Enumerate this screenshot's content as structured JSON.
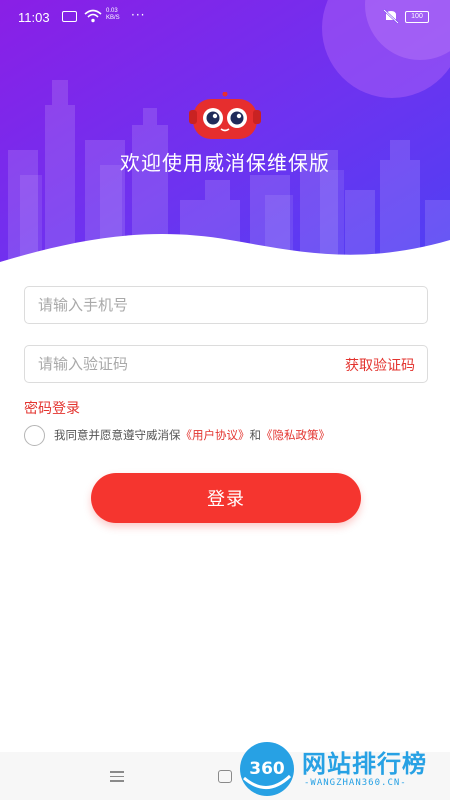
{
  "status_bar": {
    "time": "11:03",
    "net_speed_value": "0.03",
    "net_speed_unit": "KB/S",
    "more": "···",
    "battery": "100",
    "icons": [
      "notification-icon",
      "wifi-icon",
      "mute-icon",
      "battery-icon"
    ]
  },
  "header": {
    "welcome": "欢迎使用威消保维保版",
    "gradient_colors": [
      "#6a2df0",
      "#9a2be8",
      "#4b3bf2"
    ]
  },
  "form": {
    "phone_placeholder": "请输入手机号",
    "code_placeholder": "请输入验证码",
    "get_code_label": "获取验证码",
    "password_login_label": "密码登录",
    "agreement": {
      "prefix": "我同意并愿意遵守威消保",
      "user_agreement": "《用户协议》",
      "conjunction": "和",
      "privacy_policy": "《隐私政策》",
      "checked": false
    },
    "login_label": "登录"
  },
  "colors": {
    "accent": "#e3342f",
    "button": "#f5352f"
  },
  "watermark": {
    "badge": "360",
    "title": "网站排行榜",
    "subtitle": "-WANGZHAN360.CN-"
  },
  "nav_bar": {
    "icons": [
      "menu-icon",
      "home-icon"
    ]
  }
}
